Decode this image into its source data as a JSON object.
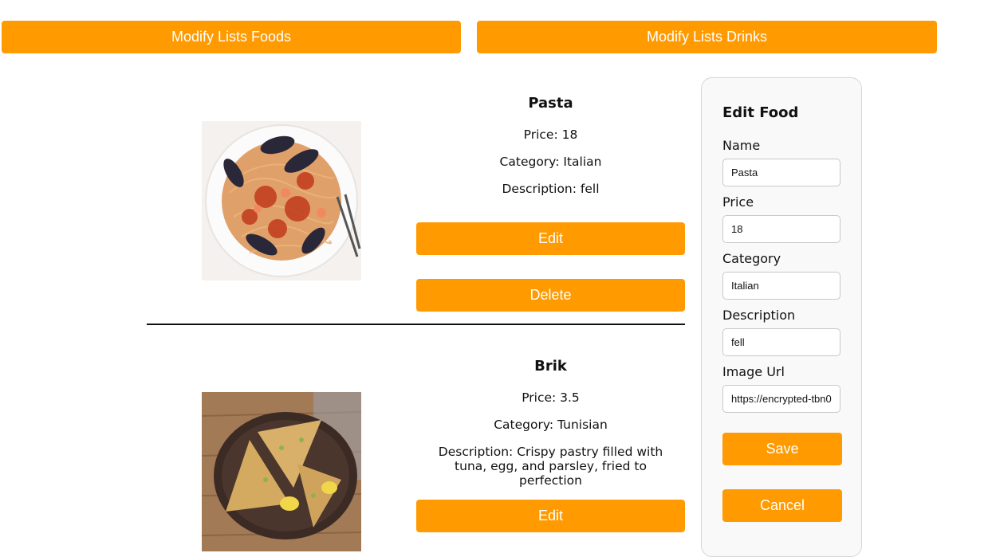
{
  "top_buttons": {
    "foods": "Modify Lists Foods",
    "drinks": "Modify Lists Drinks"
  },
  "foods": [
    {
      "name": "Pasta",
      "price": "Price: 18",
      "category": "Category: Italian",
      "description": "Description: fell",
      "edit": "Edit",
      "delete": "Delete"
    },
    {
      "name": "Brik",
      "price": "Price: 3.5",
      "category": "Category: Tunisian",
      "description": "Description: Crispy pastry filled with tuna, egg, and parsley, fried to perfection",
      "edit": "Edit"
    }
  ],
  "edit_panel": {
    "title": "Edit Food",
    "name_label": "Name",
    "name_value": "Pasta",
    "price_label": "Price",
    "price_value": "18",
    "category_label": "Category",
    "category_value": "Italian",
    "description_label": "Description",
    "description_value": "fell",
    "image_label": "Image Url",
    "image_value": "https://encrypted-tbn0",
    "save": "Save",
    "cancel": "Cancel"
  },
  "colors": {
    "accent": "#ff9a00",
    "panel_bg": "#f9f9f9"
  }
}
